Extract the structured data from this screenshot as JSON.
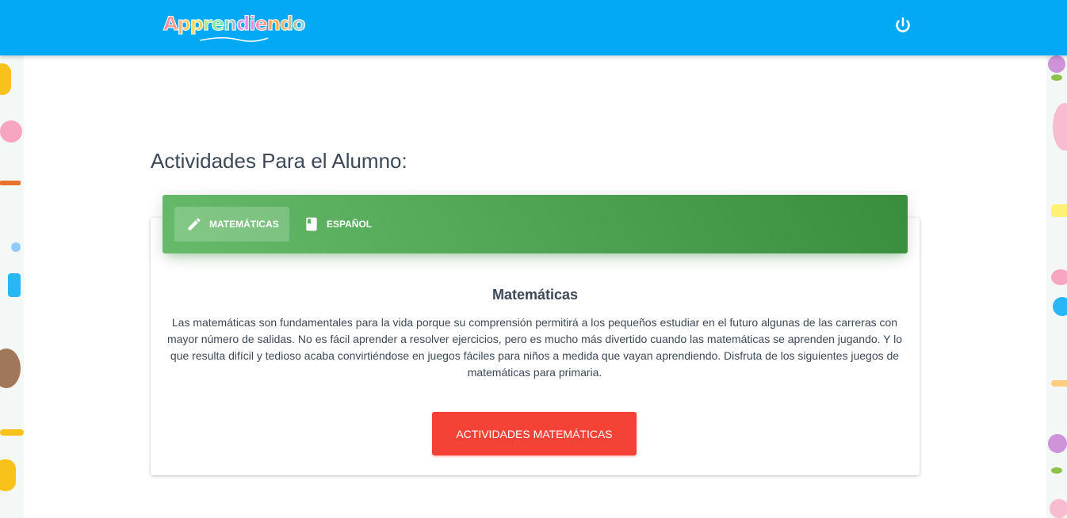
{
  "header": {
    "logo_text": "Apprendiendo",
    "brand_color": "#03a9f4",
    "power_icon": "power-icon"
  },
  "main": {
    "page_title": "Actividades Para el Alumno:",
    "tabs": [
      {
        "label": "MATEMÁTICAS",
        "icon": "pencil-icon",
        "active": true
      },
      {
        "label": "ESPAÑOL",
        "icon": "book-icon",
        "active": false
      }
    ],
    "section": {
      "title": "Matemáticas",
      "text": "Las matemáticas son fundamentales para la vida porque su comprensión permitirá a los pequeños estudiar en el futuro algunas de las carreras con mayor número de salidas. No es fácil aprender a resolver ejercicios, pero es mucho más divertido cuando las matemáticas se aprenden jugando. Y lo que resulta difícil y tedioso acaba convirtiéndose en juegos fáciles para niños a medida que vayan aprendiendo. Disfruta de los siguientes juegos de matemáticas para primaria.",
      "button_label": "ACTIVIDADES MATEMÁTICAS"
    },
    "colors": {
      "tab_header": "#4caf50",
      "cta_button": "#f44336"
    }
  }
}
